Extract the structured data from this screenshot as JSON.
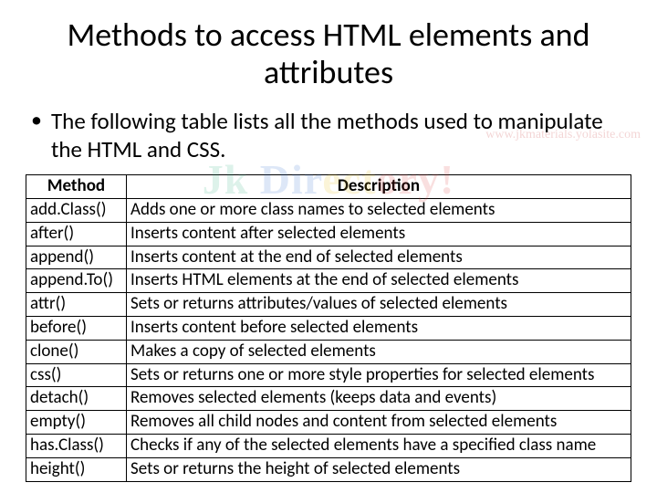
{
  "title": "Methods to access HTML elements and attributes",
  "bullet": "The following table lists all the methods used to manipulate the HTML and CSS.",
  "headers": {
    "method": "Method",
    "description": "Description"
  },
  "rows": [
    {
      "m": "add.Class()",
      "d": "Adds one or more class names to selected elements"
    },
    {
      "m": "after()",
      "d": "Inserts content after selected elements"
    },
    {
      "m": "append()",
      "d": "Inserts content at the end of selected elements"
    },
    {
      "m": "append.To()",
      "d": "Inserts HTML elements at the end of selected elements"
    },
    {
      "m": "attr()",
      "d": "Sets or returns attributes/values of selected elements"
    },
    {
      "m": "before()",
      "d": "Inserts content before selected elements"
    },
    {
      "m": "clone()",
      "d": "Makes a copy of selected elements"
    },
    {
      "m": "css()",
      "d": "Sets or returns one or more style properties for selected elements"
    },
    {
      "m": "detach()",
      "d": "Removes selected elements (keeps data and events)"
    },
    {
      "m": "empty()",
      "d": "Removes all child nodes and content from selected elements"
    },
    {
      "m": "has.Class()",
      "d": "Checks if any of the selected elements have a specified class name"
    },
    {
      "m": "height()",
      "d": "Sets or returns the height of selected elements"
    }
  ],
  "watermark_url": "www.jkmaterials.yolasite.com",
  "watermark_logo": "Jk Directory!"
}
